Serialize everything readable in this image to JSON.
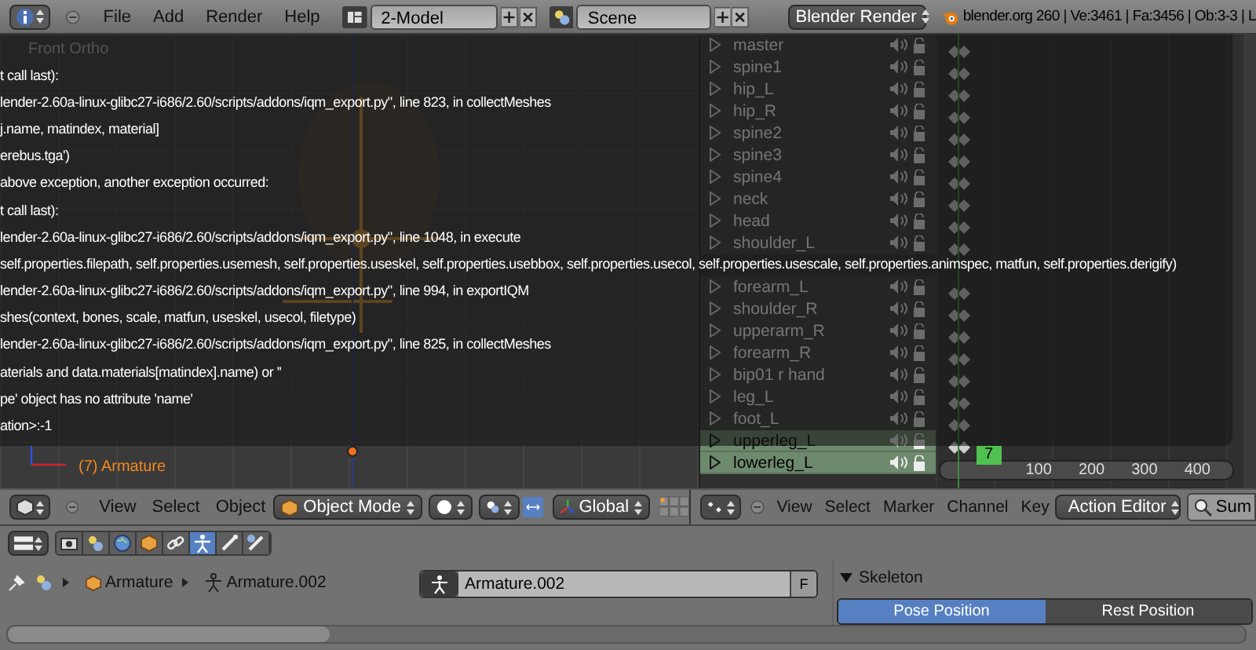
{
  "top_bar": {
    "menus": [
      "File",
      "Add",
      "Render",
      "Help"
    ],
    "screen_layout": "2-Model",
    "scene": "Scene",
    "render_engine": "Blender Render",
    "stats": "blender.org 260 | Ve:3461 | Fa:3456 | Ob:3-3 | L"
  },
  "viewport": {
    "view_label": "Front Ortho",
    "object_label": "(7) Armature"
  },
  "error_popup": {
    "lines": [
      "t call last):",
      "lender-2.60a-linux-glibc27-i686/2.60/scripts/addons/iqm_export.py\", line 823, in collectMeshes",
      "j.name, matindex, material]",
      "erebus.tga')",
      "above exception, another exception occurred:",
      "t call last):",
      "lender-2.60a-linux-glibc27-i686/2.60/scripts/addons/iqm_export.py\", line 1048, in execute",
      "self.properties.filepath, self.properties.usemesh, self.properties.useskel, self.properties.usebbox, self.properties.usecol, self.properties.usescale, self.properties.animspec, matfun, self.properties.derigify)",
      "lender-2.60a-linux-glibc27-i686/2.60/scripts/addons/iqm_export.py\", line 994, in exportIQM",
      "shes(context, bones, scale, matfun, useskel, usecol, filetype)",
      "lender-2.60a-linux-glibc27-i686/2.60/scripts/addons/iqm_export.py\", line 825, in collectMeshes",
      "aterials and data.materials[matindex].name) or ''",
      "pe' object has no attribute 'name'",
      "ation>:-1"
    ]
  },
  "dope_sheet": {
    "channels": [
      {
        "name": "master",
        "selected": false
      },
      {
        "name": "spine1",
        "selected": false
      },
      {
        "name": "hip_L",
        "selected": false
      },
      {
        "name": "hip_R",
        "selected": false
      },
      {
        "name": "spine2",
        "selected": false
      },
      {
        "name": "spine3",
        "selected": false
      },
      {
        "name": "spine4",
        "selected": false
      },
      {
        "name": "neck",
        "selected": false
      },
      {
        "name": "head",
        "selected": false
      },
      {
        "name": "shoulder_L",
        "selected": false
      },
      {
        "covered": true
      },
      {
        "name": "forearm_L",
        "selected": false
      },
      {
        "name": "shoulder_R",
        "selected": false
      },
      {
        "name": "upperarm_R",
        "selected": false
      },
      {
        "name": "forearm_R",
        "selected": false
      },
      {
        "name": "bip01 r hand",
        "selected": false
      },
      {
        "name": "leg_L",
        "selected": false
      },
      {
        "name": "foot_L",
        "selected": false
      },
      {
        "name": "upperleg_L",
        "selected": true
      },
      {
        "name": "lowerleg_L",
        "selected": true
      }
    ],
    "current_frame": "7",
    "ruler": [
      "100",
      "200",
      "300",
      "400"
    ]
  },
  "viewport_header": {
    "menus": [
      "View",
      "Select",
      "Object"
    ],
    "mode": "Object Mode",
    "orientation": "Global"
  },
  "dope_sheet_header": {
    "menus": [
      "View",
      "Select",
      "Marker",
      "Channel",
      "Key"
    ],
    "mode": "Action Editor",
    "summary": "Sum"
  },
  "properties": {
    "tabs": [
      {
        "kind": "camera",
        "selected": false
      },
      {
        "kind": "scene",
        "selected": false
      },
      {
        "kind": "world",
        "selected": false
      },
      {
        "kind": "object",
        "selected": false
      },
      {
        "kind": "link",
        "selected": false
      },
      {
        "kind": "armature",
        "selected": true
      },
      {
        "kind": "bone",
        "selected": false
      },
      {
        "kind": "bone-constraint",
        "selected": false
      }
    ],
    "breadcrumb": [
      "Armature",
      "Armature.002"
    ],
    "name_field": "Armature.002",
    "fake_user": "F",
    "panel": {
      "title": "Skeleton",
      "expanded": true,
      "buttons": [
        {
          "label": "Pose Position",
          "selected": true
        },
        {
          "label": "Rest Position",
          "selected": false
        }
      ]
    }
  }
}
